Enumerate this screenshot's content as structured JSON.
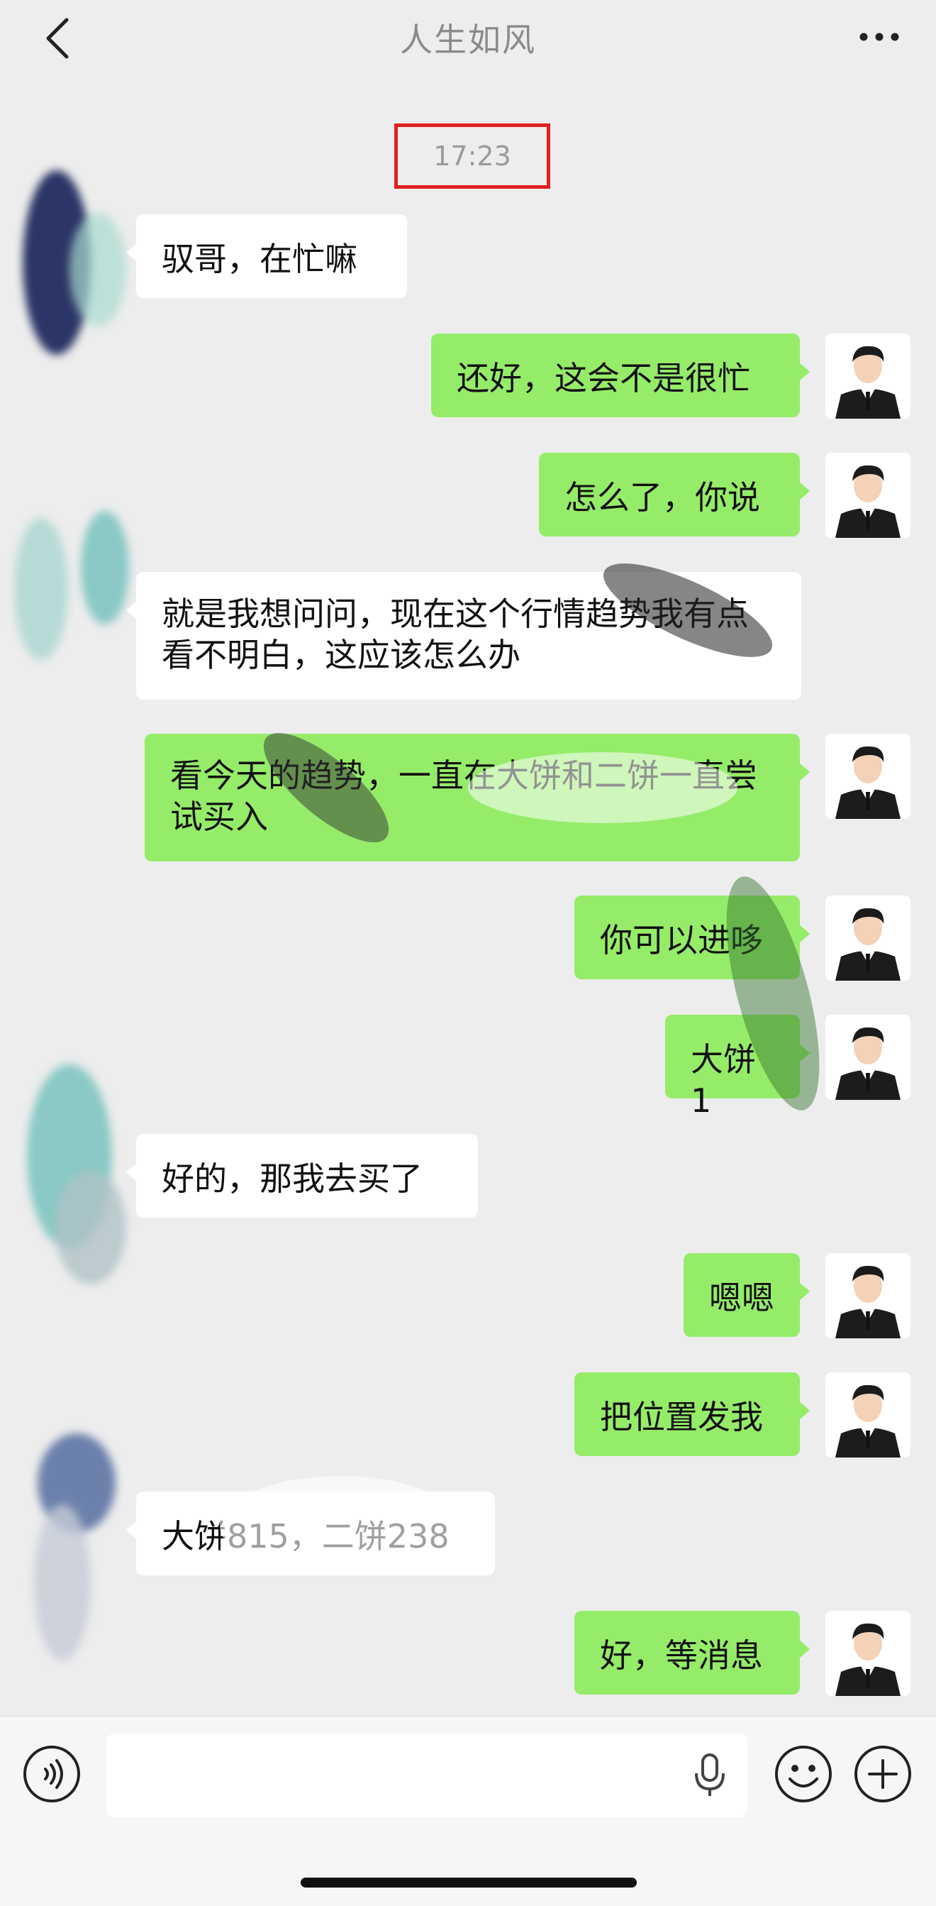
{
  "header": {
    "title": "人生如风"
  },
  "timestamp": "17:23",
  "messages": [
    {
      "side": "left",
      "text": "驭哥，在忙嘛"
    },
    {
      "side": "right",
      "text": "还好，这会不是很忙"
    },
    {
      "side": "right",
      "text": "怎么了，你说"
    },
    {
      "side": "left",
      "text": "就是我想问问，现在这个行情趋势我有点看不明白，这应该怎么办"
    },
    {
      "side": "right",
      "text": "看今天的趋势，一直在大饼和二饼一直尝试买入"
    },
    {
      "side": "right",
      "text": "你可以进哆"
    },
    {
      "side": "right",
      "text": "大饼1"
    },
    {
      "side": "left",
      "text": "好的，那我去买了"
    },
    {
      "side": "right",
      "text": "嗯嗯"
    },
    {
      "side": "right",
      "text": "把位置发我"
    },
    {
      "side": "left",
      "text": "大饼815，二饼238"
    },
    {
      "side": "right",
      "text": "好，等消息"
    }
  ],
  "input": {
    "value": "",
    "placeholder": ""
  },
  "icons": {
    "back": "chevron-left-icon",
    "more": "more-dots-icon",
    "voice": "voice-icon",
    "mic": "mic-icon",
    "emoji": "emoji-icon",
    "plus": "plus-icon"
  },
  "colors": {
    "background": "#ededed",
    "my_bubble": "#95ec69",
    "their_bubble": "#ffffff",
    "highlight_box": "#e02020"
  }
}
